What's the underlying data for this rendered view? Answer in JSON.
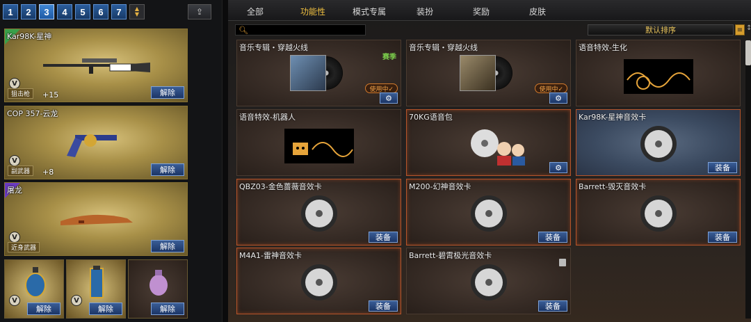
{
  "left": {
    "tabs": [
      "1",
      "2",
      "3",
      "4",
      "5",
      "6",
      "7"
    ],
    "active_tab": "3",
    "weapons": [
      {
        "name": "Kar98K-星神",
        "type": "狙击枪",
        "stat": "+15",
        "button": "解除"
      },
      {
        "name": "COP 357-云龙",
        "type": "副武器",
        "stat": "+8",
        "button": "解除"
      },
      {
        "name": "屠龙",
        "type": "近身武器",
        "stat": "",
        "button": "解除"
      }
    ],
    "small_items": [
      {
        "button": "解除"
      },
      {
        "button": "解除"
      },
      {
        "button": "解除"
      }
    ]
  },
  "right": {
    "nav": [
      "全部",
      "功能性",
      "模式专属",
      "装扮",
      "奖励",
      "皮肤"
    ],
    "active_nav": "功能性",
    "search_placeholder": "",
    "sort_label": "默认排序",
    "items": [
      {
        "name": "音乐专辑・穿越火线",
        "badge": "赛季",
        "status": "使用中✓",
        "kind": "album",
        "button": "gear"
      },
      {
        "name": "音乐专辑・穿越火线",
        "badge": "",
        "status": "使用中✓",
        "kind": "album",
        "button": "gear"
      },
      {
        "name": "语音特效-生化",
        "badge": "",
        "status": "",
        "kind": "fx",
        "button": ""
      },
      {
        "name": "语音特效-机器人",
        "badge": "",
        "status": "",
        "kind": "fx-robot",
        "button": ""
      },
      {
        "name": "70KG语音包",
        "badge": "",
        "status": "",
        "kind": "voicepack",
        "button": "gear"
      },
      {
        "name": "Kar98K-星神音效卡",
        "badge": "",
        "status": "",
        "kind": "disc",
        "button": "装备"
      },
      {
        "name": "QBZ03-金色蔷薇音效卡",
        "badge": "",
        "status": "",
        "kind": "disc",
        "button": "装备"
      },
      {
        "name": "M200-幻神音效卡",
        "badge": "",
        "status": "",
        "kind": "disc",
        "button": "装备"
      },
      {
        "name": "Barrett-毁灭音效卡",
        "badge": "",
        "status": "",
        "kind": "disc",
        "button": "装备"
      },
      {
        "name": "M4A1-雷神音效卡",
        "badge": "",
        "status": "",
        "kind": "disc",
        "button": "装备"
      },
      {
        "name": "Barrett-碧霄极光音效卡",
        "badge": "",
        "status": "",
        "kind": "disc",
        "button": "装备"
      }
    ]
  },
  "colors": {
    "accent_gold": "#f0c040",
    "button_blue": "#1b3566",
    "owned_border": "#b5542a",
    "season_green": "#7cd04c"
  }
}
